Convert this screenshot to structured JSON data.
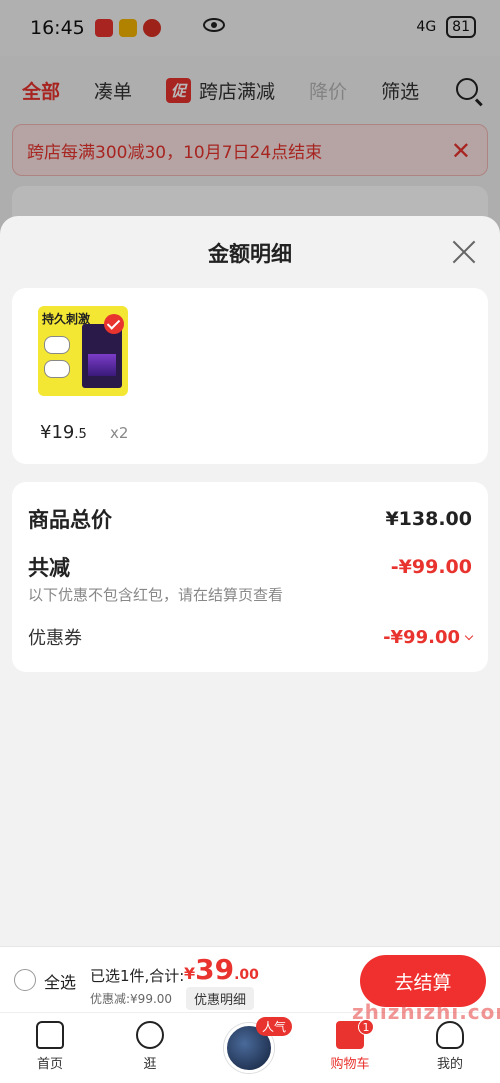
{
  "status": {
    "time": "16:45",
    "battery": "81",
    "network": "4G"
  },
  "tabs": [
    {
      "label": "全部",
      "active": true
    },
    {
      "label": "凑单"
    },
    {
      "label": "跨店满减",
      "badge": "促"
    },
    {
      "label": "降价",
      "muted": true
    },
    {
      "label": "筛选"
    }
  ],
  "promo": {
    "text": "跨店每满300减30，10月7日24点结束"
  },
  "sheet": {
    "title": "金额明细",
    "product": {
      "label": "持久刺激",
      "price_int": "¥19",
      "price_dec": ".5",
      "qty": "x2"
    },
    "summary": {
      "total_label": "商品总价",
      "total_value": "¥138.00",
      "discount_label": "共减",
      "discount_value": "-¥99.00",
      "note": "以下优惠不包含红包，请在结算页查看",
      "coupon_label": "优惠券",
      "coupon_value": "-¥99.00"
    }
  },
  "bottom": {
    "select_all": "全选",
    "selected_text": "已选1件,合计:",
    "currency": "¥",
    "total_int": "39",
    "total_dec": ".00",
    "discount_text": "优惠减:¥99.00",
    "detail_btn": "优惠明细",
    "checkout": "去结算"
  },
  "nav": {
    "home": "首页",
    "stroll": "逛",
    "hot_badge": "人气",
    "cart": "购物车",
    "cart_count": "1",
    "me": "我的"
  },
  "watermark": "zhizhizhi.com",
  "colors": {
    "accent": "#e8332e"
  }
}
